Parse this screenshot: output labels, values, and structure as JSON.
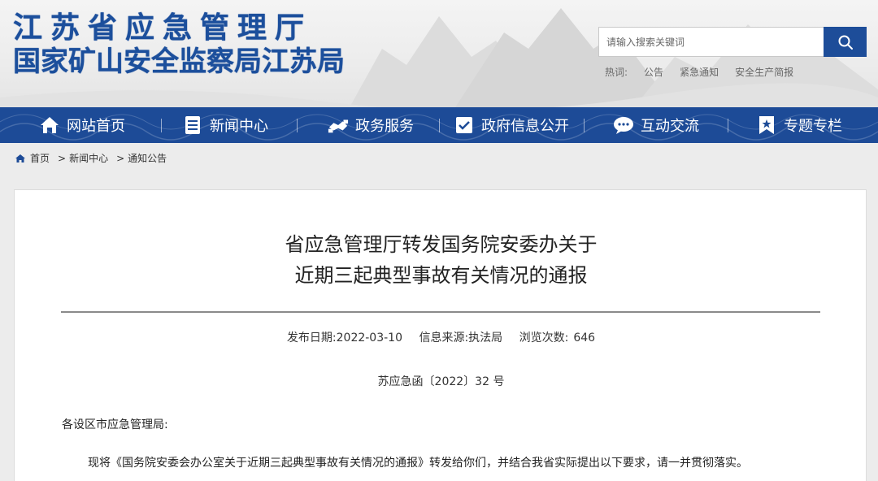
{
  "header": {
    "logo_line1": "江苏省应急管理厅",
    "logo_line2": "国家矿山安全监察局江苏局",
    "search": {
      "placeholder": "请输入搜索关键词",
      "button_icon": "search-icon"
    },
    "hotwords": {
      "label": "热词:",
      "items": [
        "公告",
        "紧急通知",
        "安全生产简报"
      ]
    }
  },
  "nav": {
    "items": [
      {
        "label": "网站首页",
        "icon": "home-icon"
      },
      {
        "label": "新闻中心",
        "icon": "newspaper-icon"
      },
      {
        "label": "政务服务",
        "icon": "handshake-icon"
      },
      {
        "label": "政府信息公开",
        "icon": "document-check-icon"
      },
      {
        "label": "互动交流",
        "icon": "chat-bubble-icon"
      },
      {
        "label": "专题专栏",
        "icon": "bookmark-icon"
      }
    ],
    "colors": {
      "background": "#1d4b97",
      "text": "#ffffff"
    }
  },
  "breadcrumb": {
    "items": [
      "首页",
      "新闻中心",
      "通知公告"
    ],
    "separator": ">"
  },
  "article": {
    "title_line1": "省应急管理厅转发国务院安委办关于",
    "title_line2": "近期三起典型事故有关情况的通报",
    "meta": {
      "date_label": "发布日期:",
      "date": "2022-03-10",
      "source_label": "信息来源:",
      "source": "执法局",
      "views_label": "浏览次数:",
      "views": "646"
    },
    "doc_number": "苏应急函〔2022〕32 号",
    "salutation": "各设区市应急管理局:",
    "paragraph": "现将《国务院安委会办公室关于近期三起典型事故有关情况的通报》转发给你们，并结合我省实际提出以下要求，请一并贯彻落实。"
  },
  "colors": {
    "brand": "#1c4f9c",
    "search_button": "#1d4d99"
  }
}
